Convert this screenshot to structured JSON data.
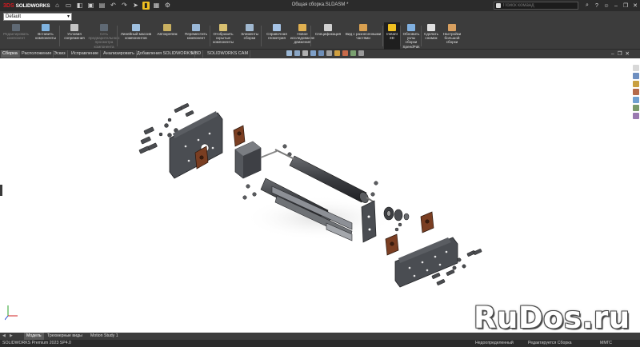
{
  "app": {
    "brand_ds": "3DS",
    "brand_sw": "SOLIDWORKS",
    "document_title": "Общая сборка.SLDASM *"
  },
  "search": {
    "placeholder": "Поиск команд"
  },
  "config": {
    "selected": "Default"
  },
  "ribbon": {
    "buttons": [
      {
        "label": "Редактировать\nкомпонент",
        "icon": "edit-component-icon",
        "enabled": false
      },
      {
        "label": "Вставить\nкомпоненты",
        "icon": "insert-components-icon",
        "enabled": true
      },
      {
        "label": "Условия\nсопряжения",
        "icon": "mate-icon",
        "enabled": true
      },
      {
        "label": "Сеть\nпредварительного\nпросмотра\nкомпонента",
        "icon": "preview-icon",
        "enabled": false
      },
      {
        "label": "Линейный массив\nкомпонентов",
        "icon": "linear-pattern-icon",
        "enabled": true
      },
      {
        "label": "Автокрепеж",
        "icon": "smart-fasteners-icon",
        "enabled": true
      },
      {
        "label": "Переместить\nкомпонент",
        "icon": "move-component-icon",
        "enabled": true
      },
      {
        "label": "Отобразить\nскрытые\nкомпоненты",
        "icon": "show-hidden-icon",
        "enabled": true
      },
      {
        "label": "Элементы\nсборки",
        "icon": "assembly-features-icon",
        "enabled": true
      },
      {
        "label": "Справочная\nгеометрия",
        "icon": "reference-geometry-icon",
        "enabled": true
      },
      {
        "label": "Новое\nисследование\nдвижения",
        "icon": "motion-study-icon",
        "enabled": true
      },
      {
        "label": "Спецификация",
        "icon": "bom-icon",
        "enabled": true
      },
      {
        "label": "Вид с разнесенными\nчастями",
        "icon": "exploded-view-icon",
        "enabled": true
      },
      {
        "label": "Instant\n3D",
        "icon": "instant3d-icon",
        "enabled": true,
        "selected": true
      },
      {
        "label": "Обновить\nузлы\nсборки\nSpeedPak",
        "icon": "speedpak-icon",
        "enabled": true
      },
      {
        "label": "Сделать\nснимок",
        "icon": "snapshot-icon",
        "enabled": true
      },
      {
        "label": "Настройки\nбольшой\nсборки",
        "icon": "large-assembly-icon",
        "enabled": true
      }
    ]
  },
  "tabs": [
    "Сборка",
    "Расположение",
    "Эскиз",
    "Исправление",
    "Анализировать",
    "Добавления SOLIDWORKS",
    "MBD",
    "SOLIDWORKS CAM"
  ],
  "bottom_tabs": [
    "Модель",
    "Трехмерные виды",
    "Motion Study 1"
  ],
  "status": {
    "left": "SOLIDWORKS Premium 2023 SP4.0",
    "underdefined": "Недоопределенный",
    "editing": "Редактируется Сборка",
    "units": "MMГС"
  },
  "watermark": "RuDos.ru",
  "colors": {
    "chrome_dark": "#2b2b2b",
    "chrome_mid": "#3c3c3c",
    "accent_yellow": "#f0c020",
    "part_gray": "#3f4146",
    "part_brown": "#8a4a2a"
  }
}
